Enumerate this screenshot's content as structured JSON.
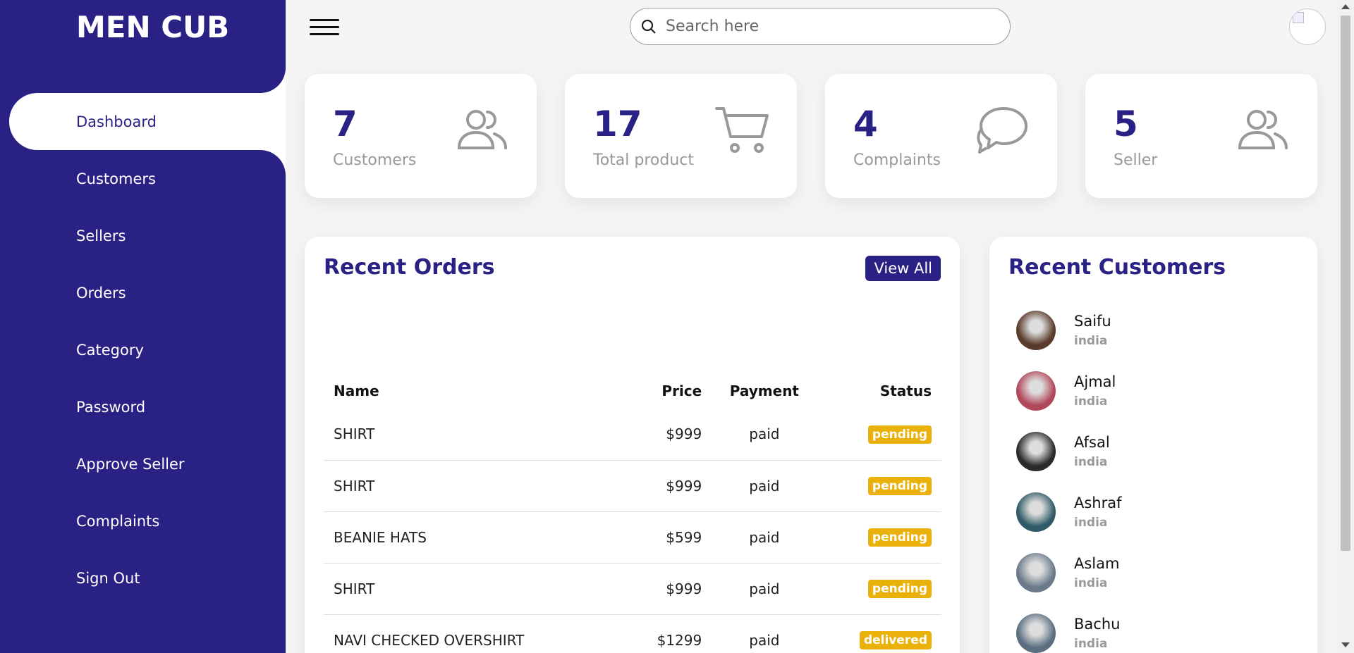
{
  "brand": "MEN CUB",
  "sidebar": {
    "items": [
      {
        "label": "Dashboard",
        "active": true
      },
      {
        "label": "Customers"
      },
      {
        "label": "Sellers"
      },
      {
        "label": "Orders"
      },
      {
        "label": "Category"
      },
      {
        "label": "Password"
      },
      {
        "label": "Approve Seller"
      },
      {
        "label": "Complaints"
      },
      {
        "label": "Sign Out"
      }
    ]
  },
  "search": {
    "placeholder": "Search here"
  },
  "cards": [
    {
      "number": "7",
      "label": "Customers",
      "icon": "people-icon"
    },
    {
      "number": "17",
      "label": "Total product",
      "icon": "cart-icon"
    },
    {
      "number": "4",
      "label": "Complaints",
      "icon": "chat-icon"
    },
    {
      "number": "5",
      "label": "Seller",
      "icon": "people-icon"
    }
  ],
  "orders": {
    "title": "Recent Orders",
    "view_all": "View All",
    "headers": {
      "name": "Name",
      "price": "Price",
      "payment": "Payment",
      "status": "Status"
    },
    "rows": [
      {
        "name": "SHIRT",
        "price": "$999",
        "payment": "paid",
        "status": "pending"
      },
      {
        "name": "SHIRT",
        "price": "$999",
        "payment": "paid",
        "status": "pending"
      },
      {
        "name": "BEANIE HATS",
        "price": "$599",
        "payment": "paid",
        "status": "pending"
      },
      {
        "name": "SHIRT",
        "price": "$999",
        "payment": "paid",
        "status": "pending"
      },
      {
        "name": "NAVI CHECKED OVERSHIRT",
        "price": "$1299",
        "payment": "paid",
        "status": "delivered"
      }
    ]
  },
  "customers": {
    "title": "Recent Customers",
    "list": [
      {
        "name": "Saifu",
        "country": "india",
        "color": "#5a3a2a"
      },
      {
        "name": "Ajmal",
        "country": "india",
        "color": "#b0485a"
      },
      {
        "name": "Afsal",
        "country": "india",
        "color": "#2a2a2a"
      },
      {
        "name": "Ashraf",
        "country": "india",
        "color": "#2f5a66"
      },
      {
        "name": "Aslam",
        "country": "india",
        "color": "#6a7a8a"
      },
      {
        "name": "Bachu",
        "country": "india",
        "color": "#5a6e80"
      }
    ]
  },
  "colors": {
    "primary": "#2a2185",
    "badge": "#e9b10a"
  }
}
